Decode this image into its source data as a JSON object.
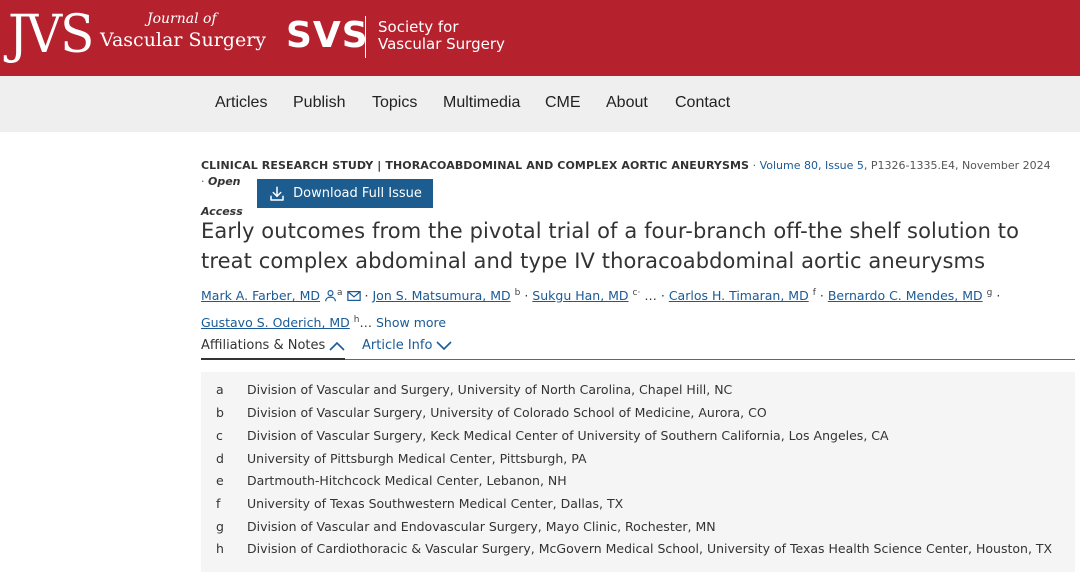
{
  "header": {
    "logo": "JVS",
    "journal_small": "Journal of",
    "journal_name": "Vascular Surgery",
    "society_logo": "SVS",
    "society_line1": "Society for",
    "society_line2": "Vascular Surgery",
    "brand_color": "#b5222e"
  },
  "nav": [
    "Articles",
    "Publish",
    "Topics",
    "Multimedia",
    "CME",
    "About",
    "Contact"
  ],
  "article": {
    "section": "CLINICAL RESEARCH STUDY | THORACOABDOMINAL AND COMPLEX AORTIC ANEURYSMS",
    "separator": "·",
    "volume_issue": "Volume 80, Issue 5",
    "pages_date": ", P1326-1335.E4, November 2024",
    "open_word": "Open",
    "access_word": "Access",
    "download_label": "Download Full Issue",
    "title": "Early outcomes from the pivotal trial of a four-branch off-the shelf solution to treat complex abdominal and type IV thoracoabdominal aortic aneurysms",
    "authors": [
      {
        "name": "Mark A. Farber, MD",
        "sup": "a"
      },
      {
        "name": "Jon S. Matsumura, MD",
        "sup": "b"
      },
      {
        "name": "Sukgu Han, MD",
        "sup": "c"
      },
      {
        "name": "Carlos H. Timaran, MD",
        "sup": "f"
      },
      {
        "name": "Bernardo C. Mendes, MD",
        "sup": "g"
      },
      {
        "name": "Gustavo S. Oderich, MD",
        "sup": "h"
      }
    ],
    "ellipsis": "…",
    "show_more": "Show more"
  },
  "tabs": {
    "affiliations": "Affiliations & Notes",
    "article_info": "Article Info"
  },
  "affiliations": [
    {
      "letter": "a",
      "text": "Division of Vascular and Surgery, University of North Carolina, Chapel Hill, NC"
    },
    {
      "letter": "b",
      "text": "Division of Vascular Surgery, University of Colorado School of Medicine, Aurora, CO"
    },
    {
      "letter": "c",
      "text": "Division of Vascular Surgery, Keck Medical Center of University of Southern California, Los Angeles, CA"
    },
    {
      "letter": "d",
      "text": "University of Pittsburgh Medical Center, Pittsburgh, PA"
    },
    {
      "letter": "e",
      "text": "Dartmouth-Hitchcock Medical Center, Lebanon, NH"
    },
    {
      "letter": "f",
      "text": "University of Texas Southwestern Medical Center, Dallas, TX"
    },
    {
      "letter": "g",
      "text": "Division of Vascular and Endovascular Surgery, Mayo Clinic, Rochester, MN"
    },
    {
      "letter": "h",
      "text": "Division of Cardiothoracic & Vascular Surgery, McGovern Medical School, University of Texas Health Science Center, Houston, TX"
    }
  ]
}
